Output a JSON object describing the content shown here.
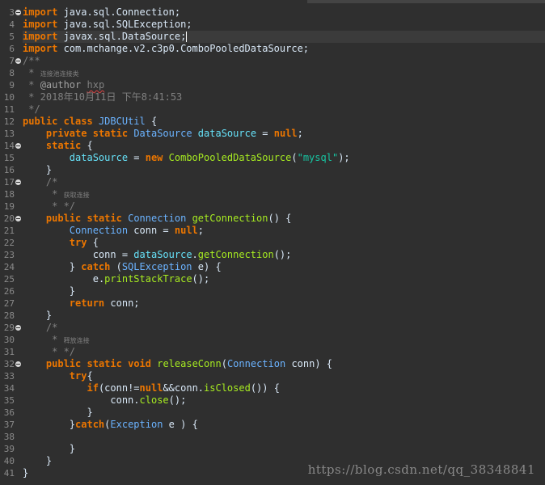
{
  "editor": {
    "watermark": "https://blog.csdn.net/qq_38348841",
    "lines": [
      {
        "n": "3",
        "fold": true,
        "tokens": [
          [
            "kw",
            "import"
          ],
          [
            "plain",
            " java.sql.Connection;"
          ]
        ]
      },
      {
        "n": "4",
        "tokens": [
          [
            "kw",
            "import"
          ],
          [
            "plain",
            " java.sql.SQLException;"
          ]
        ]
      },
      {
        "n": "5",
        "current": true,
        "caret": true,
        "tokens": [
          [
            "kw",
            "import"
          ],
          [
            "plain",
            " javax.sql.DataSource;"
          ]
        ]
      },
      {
        "n": "6",
        "tokens": [
          [
            "kw",
            "import"
          ],
          [
            "plain",
            " com.mchange.v2.c3p0.ComboPooledDataSource;"
          ]
        ]
      },
      {
        "n": "7",
        "fold": true,
        "tokens": [
          [
            "cmt",
            "/**"
          ]
        ]
      },
      {
        "n": "8",
        "tokens": [
          [
            "cmt",
            " * "
          ],
          [
            "cmt-small",
            "连接池连接类"
          ]
        ]
      },
      {
        "n": "9",
        "tokens": [
          [
            "cmt",
            " * "
          ],
          [
            "ann",
            "@author"
          ],
          [
            "cmt",
            " "
          ],
          [
            "cmt squiggle",
            "hxp"
          ]
        ]
      },
      {
        "n": "10",
        "tokens": [
          [
            "cmt",
            " * 2018年10月11日 下午8:41:53"
          ]
        ]
      },
      {
        "n": "11",
        "tokens": [
          [
            "cmt",
            " */"
          ]
        ]
      },
      {
        "n": "12",
        "tokens": [
          [
            "kw",
            "public"
          ],
          [
            "plain",
            " "
          ],
          [
            "kw",
            "class"
          ],
          [
            "plain",
            " "
          ],
          [
            "type",
            "JDBCUtil"
          ],
          [
            "plain",
            " {"
          ]
        ]
      },
      {
        "n": "13",
        "tokens": [
          [
            "plain",
            "    "
          ],
          [
            "kw",
            "private"
          ],
          [
            "plain",
            " "
          ],
          [
            "kw",
            "static"
          ],
          [
            "plain",
            " "
          ],
          [
            "type",
            "DataSource"
          ],
          [
            "plain",
            " "
          ],
          [
            "field",
            "dataSource"
          ],
          [
            "plain",
            " = "
          ],
          [
            "kw",
            "null"
          ],
          [
            "plain",
            ";"
          ]
        ]
      },
      {
        "n": "14",
        "fold": true,
        "tokens": [
          [
            "plain",
            "    "
          ],
          [
            "kw",
            "static"
          ],
          [
            "plain",
            " {"
          ]
        ]
      },
      {
        "n": "15",
        "tokens": [
          [
            "plain",
            "        "
          ],
          [
            "field",
            "dataSource"
          ],
          [
            "plain",
            " = "
          ],
          [
            "kw",
            "new"
          ],
          [
            "plain",
            " "
          ],
          [
            "method",
            "ComboPooledDataSource"
          ],
          [
            "plain",
            "("
          ],
          [
            "str",
            "\"mysql\""
          ],
          [
            "plain",
            ");"
          ]
        ]
      },
      {
        "n": "16",
        "tokens": [
          [
            "plain",
            "    }"
          ]
        ]
      },
      {
        "n": "17",
        "fold": true,
        "tokens": [
          [
            "plain",
            "    "
          ],
          [
            "cmt",
            "/*"
          ]
        ]
      },
      {
        "n": "18",
        "tokens": [
          [
            "plain",
            "    "
          ],
          [
            "cmt",
            " * "
          ],
          [
            "cmt-small",
            "获取连接"
          ]
        ]
      },
      {
        "n": "19",
        "tokens": [
          [
            "plain",
            "    "
          ],
          [
            "cmt",
            " * */"
          ]
        ]
      },
      {
        "n": "20",
        "fold": true,
        "tokens": [
          [
            "plain",
            "    "
          ],
          [
            "kw",
            "public"
          ],
          [
            "plain",
            " "
          ],
          [
            "kw",
            "static"
          ],
          [
            "plain",
            " "
          ],
          [
            "type",
            "Connection"
          ],
          [
            "plain",
            " "
          ],
          [
            "method",
            "getConnection"
          ],
          [
            "plain",
            "() {"
          ]
        ]
      },
      {
        "n": "21",
        "tokens": [
          [
            "plain",
            "        "
          ],
          [
            "type",
            "Connection"
          ],
          [
            "plain",
            " "
          ],
          [
            "local",
            "conn"
          ],
          [
            "plain",
            " = "
          ],
          [
            "kw",
            "null"
          ],
          [
            "plain",
            ";"
          ]
        ]
      },
      {
        "n": "22",
        "tokens": [
          [
            "plain",
            "        "
          ],
          [
            "kw",
            "try"
          ],
          [
            "plain",
            " {"
          ]
        ]
      },
      {
        "n": "23",
        "tokens": [
          [
            "plain",
            "            "
          ],
          [
            "local",
            "conn"
          ],
          [
            "plain",
            " = "
          ],
          [
            "field",
            "dataSource"
          ],
          [
            "plain",
            "."
          ],
          [
            "method",
            "getConnection"
          ],
          [
            "plain",
            "();"
          ]
        ]
      },
      {
        "n": "24",
        "tokens": [
          [
            "plain",
            "        } "
          ],
          [
            "kw",
            "catch"
          ],
          [
            "plain",
            " ("
          ],
          [
            "type",
            "SQLException"
          ],
          [
            "plain",
            " "
          ],
          [
            "local",
            "e"
          ],
          [
            "plain",
            ") {"
          ]
        ]
      },
      {
        "n": "25",
        "tokens": [
          [
            "plain",
            "            "
          ],
          [
            "local",
            "e"
          ],
          [
            "plain",
            "."
          ],
          [
            "method",
            "printStackTrace"
          ],
          [
            "plain",
            "();"
          ]
        ]
      },
      {
        "n": "26",
        "tokens": [
          [
            "plain",
            "        }"
          ]
        ]
      },
      {
        "n": "27",
        "tokens": [
          [
            "plain",
            "        "
          ],
          [
            "kw",
            "return"
          ],
          [
            "plain",
            " "
          ],
          [
            "local",
            "conn"
          ],
          [
            "plain",
            ";"
          ]
        ]
      },
      {
        "n": "28",
        "tokens": [
          [
            "plain",
            "    }"
          ]
        ]
      },
      {
        "n": "29",
        "fold": true,
        "tokens": [
          [
            "plain",
            "    "
          ],
          [
            "cmt",
            "/*"
          ]
        ]
      },
      {
        "n": "30",
        "tokens": [
          [
            "plain",
            "    "
          ],
          [
            "cmt",
            " * "
          ],
          [
            "cmt-small",
            "释放连接"
          ]
        ]
      },
      {
        "n": "31",
        "tokens": [
          [
            "plain",
            "    "
          ],
          [
            "cmt",
            " * */"
          ]
        ]
      },
      {
        "n": "32",
        "fold": true,
        "tokens": [
          [
            "plain",
            "    "
          ],
          [
            "kw",
            "public"
          ],
          [
            "plain",
            " "
          ],
          [
            "kw",
            "static"
          ],
          [
            "plain",
            " "
          ],
          [
            "kw",
            "void"
          ],
          [
            "plain",
            " "
          ],
          [
            "method",
            "releaseConn"
          ],
          [
            "plain",
            "("
          ],
          [
            "type",
            "Connection"
          ],
          [
            "plain",
            " "
          ],
          [
            "local",
            "conn"
          ],
          [
            "plain",
            ") {"
          ]
        ]
      },
      {
        "n": "33",
        "tokens": [
          [
            "plain",
            "        "
          ],
          [
            "kw",
            "try"
          ],
          [
            "plain",
            "{"
          ]
        ]
      },
      {
        "n": "34",
        "tokens": [
          [
            "plain",
            "           "
          ],
          [
            "kw",
            "if"
          ],
          [
            "plain",
            "("
          ],
          [
            "local",
            "conn"
          ],
          [
            "plain",
            "!="
          ],
          [
            "kw",
            "null"
          ],
          [
            "plain",
            "&&"
          ],
          [
            "local",
            "conn"
          ],
          [
            "plain",
            "."
          ],
          [
            "method",
            "isClosed"
          ],
          [
            "plain",
            "()) {"
          ]
        ]
      },
      {
        "n": "35",
        "tokens": [
          [
            "plain",
            "               "
          ],
          [
            "local",
            "conn"
          ],
          [
            "plain",
            "."
          ],
          [
            "method",
            "close"
          ],
          [
            "plain",
            "();"
          ]
        ]
      },
      {
        "n": "36",
        "tokens": [
          [
            "plain",
            "           }"
          ]
        ]
      },
      {
        "n": "37",
        "tokens": [
          [
            "plain",
            "        }"
          ],
          [
            "kw",
            "catch"
          ],
          [
            "plain",
            "("
          ],
          [
            "type",
            "Exception"
          ],
          [
            "plain",
            " "
          ],
          [
            "local",
            "e"
          ],
          [
            "plain",
            " ) {"
          ]
        ]
      },
      {
        "n": "38",
        "tokens": [
          [
            "plain",
            ""
          ]
        ]
      },
      {
        "n": "39",
        "tokens": [
          [
            "plain",
            "        }"
          ]
        ]
      },
      {
        "n": "40",
        "tokens": [
          [
            "plain",
            "    }"
          ]
        ]
      },
      {
        "n": "41",
        "tokens": [
          [
            "plain",
            "}"
          ]
        ]
      }
    ]
  }
}
